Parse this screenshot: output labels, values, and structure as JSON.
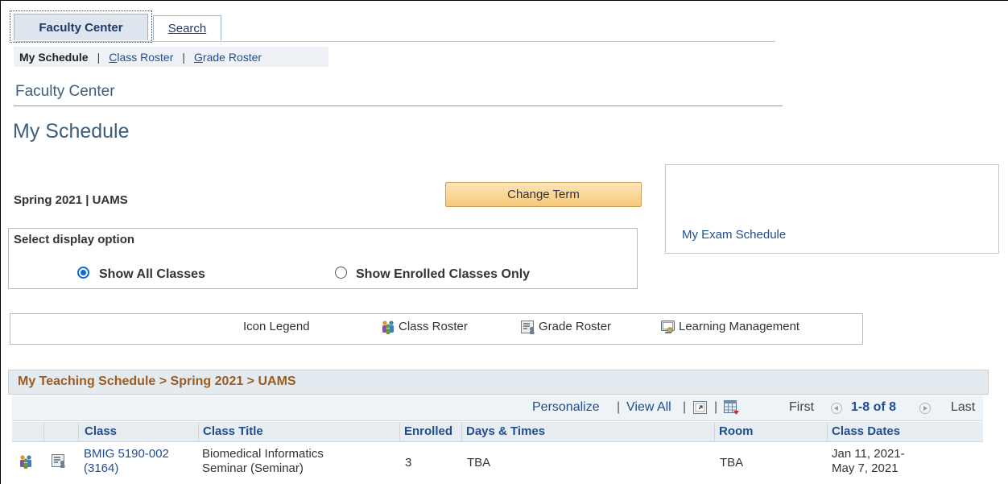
{
  "tabs": {
    "faculty_center": "Faculty Center",
    "search": "Search"
  },
  "subnav": {
    "my_schedule": "My Schedule",
    "sep1": "|",
    "class_roster_ul": "C",
    "class_roster_rest": "lass Roster",
    "sep2": "|",
    "grade_roster_ul": "G",
    "grade_roster_rest": "rade Roster"
  },
  "page": {
    "section_title": "Faculty Center",
    "page_title": "My Schedule",
    "term_label": "Spring 2021 | UAMS",
    "change_term_button": "Change Term",
    "exam_schedule_link": "My Exam Schedule"
  },
  "display_option": {
    "label": "Select display option",
    "options": [
      {
        "label": "Show All Classes",
        "selected": true
      },
      {
        "label": "Show Enrolled Classes Only",
        "selected": false
      }
    ]
  },
  "legend": {
    "title": "Icon Legend",
    "items": [
      {
        "icon": "class-roster-icon",
        "label": "Class Roster"
      },
      {
        "icon": "grade-roster-icon",
        "label": "Grade Roster"
      },
      {
        "icon": "learning-management-icon",
        "label": "Learning Management"
      }
    ]
  },
  "grid": {
    "title": "My Teaching Schedule > Spring 2021 > UAMS",
    "personalize": "Personalize",
    "view_all": "View All",
    "sep": "|",
    "first": "First",
    "count": "1-8 of 8",
    "last": "Last",
    "columns": [
      "Class",
      "Class Title",
      "Enrolled",
      "Days & Times",
      "Room",
      "Class Dates"
    ],
    "rows": [
      {
        "class_line1": "BMIG 5190-002",
        "class_line2": "(3164)",
        "title_line1": "Biomedical Informatics",
        "title_line2": "Seminar (Seminar)",
        "enrolled": "3",
        "days_times": "TBA",
        "room": "TBA",
        "dates_line1": "Jan 11, 2021-",
        "dates_line2": "May 7, 2021"
      }
    ]
  },
  "colors": {
    "link": "#1f4d91",
    "grid_title": "#9b5b1e",
    "button_bg": "#f7c879",
    "radio_selected": "#0b6cd8"
  }
}
